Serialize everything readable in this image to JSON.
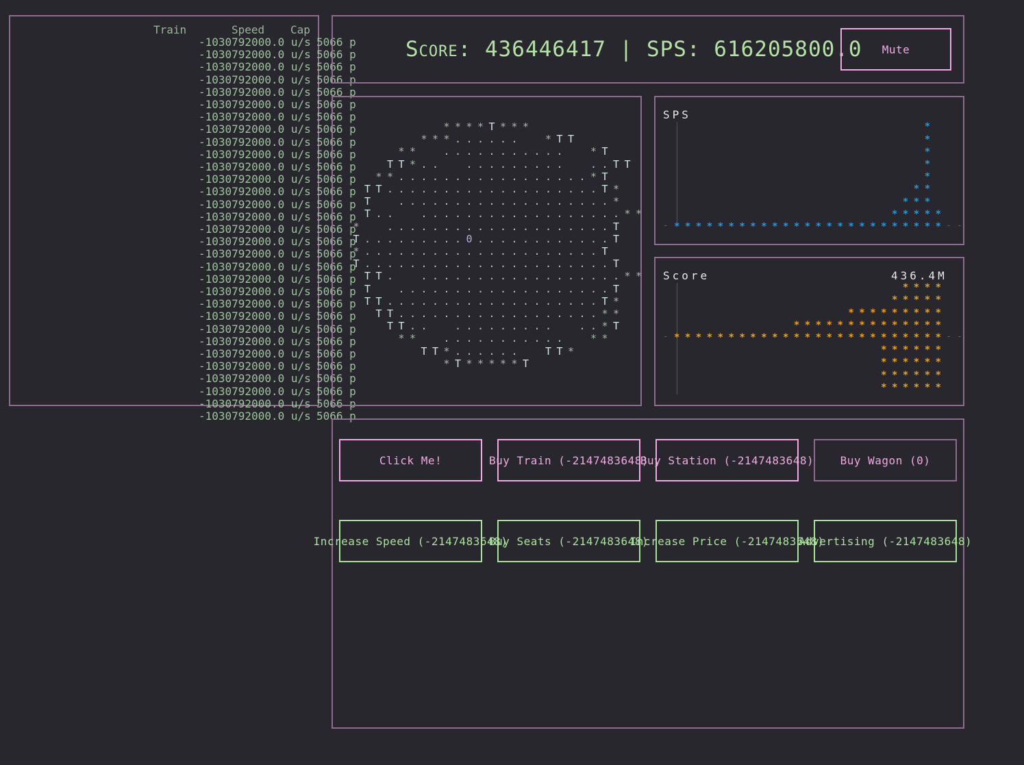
{
  "header": {
    "score_label": "Score",
    "score_value": "436446417",
    "sps_label": "SPS",
    "sps_value": "616205800.0",
    "mute_label": "Mute"
  },
  "trains_table": {
    "headers": [
      "Train",
      "Speed",
      "Cap"
    ],
    "rows": [
      {
        "speed": "-1030792000.0 u/s",
        "cap": "5066 p"
      },
      {
        "speed": "-1030792000.0 u/s",
        "cap": "5066 p"
      },
      {
        "speed": "-1030792000.0 u/s",
        "cap": "5066 p"
      },
      {
        "speed": "-1030792000.0 u/s",
        "cap": "5066 p"
      },
      {
        "speed": "-1030792000.0 u/s",
        "cap": "5066 p"
      },
      {
        "speed": "-1030792000.0 u/s",
        "cap": "5066 p"
      },
      {
        "speed": "-1030792000.0 u/s",
        "cap": "5066 p"
      },
      {
        "speed": "-1030792000.0 u/s",
        "cap": "5066 p"
      },
      {
        "speed": "-1030792000.0 u/s",
        "cap": "5066 p"
      },
      {
        "speed": "-1030792000.0 u/s",
        "cap": "5066 p"
      },
      {
        "speed": "-1030792000.0 u/s",
        "cap": "5066 p"
      },
      {
        "speed": "-1030792000.0 u/s",
        "cap": "5066 p"
      },
      {
        "speed": "-1030792000.0 u/s",
        "cap": "5066 p"
      },
      {
        "speed": "-1030792000.0 u/s",
        "cap": "5066 p"
      },
      {
        "speed": "-1030792000.0 u/s",
        "cap": "5066 p"
      },
      {
        "speed": "-1030792000.0 u/s",
        "cap": "5066 p"
      },
      {
        "speed": "-1030792000.0 u/s",
        "cap": "5066 p"
      },
      {
        "speed": "-1030792000.0 u/s",
        "cap": "5066 p"
      },
      {
        "speed": "-1030792000.0 u/s",
        "cap": "5066 p"
      },
      {
        "speed": "-1030792000.0 u/s",
        "cap": "5066 p"
      },
      {
        "speed": "-1030792000.0 u/s",
        "cap": "5066 p"
      },
      {
        "speed": "-1030792000.0 u/s",
        "cap": "5066 p"
      },
      {
        "speed": "-1030792000.0 u/s",
        "cap": "5066 p"
      },
      {
        "speed": "-1030792000.0 u/s",
        "cap": "5066 p"
      },
      {
        "speed": "-1030792000.0 u/s",
        "cap": "5066 p"
      },
      {
        "speed": "-1030792000.0 u/s",
        "cap": "5066 p"
      },
      {
        "speed": "-1030792000.0 u/s",
        "cap": "5066 p"
      },
      {
        "speed": "-1030792000.0 u/s",
        "cap": "5066 p"
      },
      {
        "speed": "-1030792000.0 u/s",
        "cap": "5066 p"
      },
      {
        "speed": "-1030792000.0 u/s",
        "cap": "5066 p"
      },
      {
        "speed": "-1030792000.0 u/s",
        "cap": "5066 p"
      }
    ]
  },
  "track_view": {
    "rows": [
      "        ****T***         ",
      "      ***......  *TT     ",
      "    **  ...........  *T  ",
      "   TT*..  .........  ..TT",
      "  **.................*T  ",
      " TT...................T* ",
      " T  ...................* ",
      " T..  ..................**",
      "*  ....................T",
      "T.........0............T",
      "*.....................T",
      "T......................T",
      " TT.  ..................**",
      " T  ...................T ",
      " TT...................T* ",
      "  TT..................** ",
      "   TT..  .........  ..*T ",
      "    **  ...........  ** ",
      "      TT*......  TT*     ",
      "        *T*****T         "
    ],
    "colors": {
      "star": "#a6b9a6",
      "train": "#cfe8e8",
      "dot": "#b8c8c8",
      "center": "#b9b0dd"
    }
  },
  "sps_graph": {
    "title": "SPS",
    "color": "#2a97d8",
    "columns": [
      1,
      1,
      1,
      1,
      1,
      1,
      1,
      1,
      1,
      1,
      1,
      1,
      1,
      1,
      1,
      1,
      1,
      1,
      1,
      1,
      2,
      3,
      4,
      9,
      2
    ]
  },
  "score_graph": {
    "title": "Score",
    "value_label": "436.4M",
    "color": "#eaa020",
    "above": [
      0,
      0,
      0,
      0,
      0,
      0,
      0,
      0,
      0,
      0,
      0,
      1,
      1,
      1,
      1,
      1,
      2,
      2,
      2,
      2,
      3,
      4,
      4,
      4,
      4
    ],
    "below": [
      0,
      0,
      0,
      0,
      0,
      0,
      0,
      0,
      0,
      0,
      0,
      0,
      0,
      0,
      0,
      0,
      0,
      0,
      0,
      4,
      4,
      4,
      4,
      4,
      4
    ],
    "dim_columns": [
      0,
      1
    ]
  },
  "actions": {
    "row1": [
      {
        "label": "Click Me!",
        "style": "pink"
      },
      {
        "label": "Buy Train (-2147483648)",
        "style": "pink"
      },
      {
        "label": "Buy Station (-2147483648)",
        "style": "pink"
      },
      {
        "label": "Buy Wagon (0)",
        "style": "dim"
      }
    ],
    "row2": [
      {
        "label": "Increase Speed (-2147483648)",
        "style": "green"
      },
      {
        "label": "Buy Seats (-2147483648)",
        "style": "green"
      },
      {
        "label": "Increase Price (-2147483648)",
        "style": "green"
      },
      {
        "label": "Advertising (-2147483648)",
        "style": "green"
      }
    ]
  }
}
